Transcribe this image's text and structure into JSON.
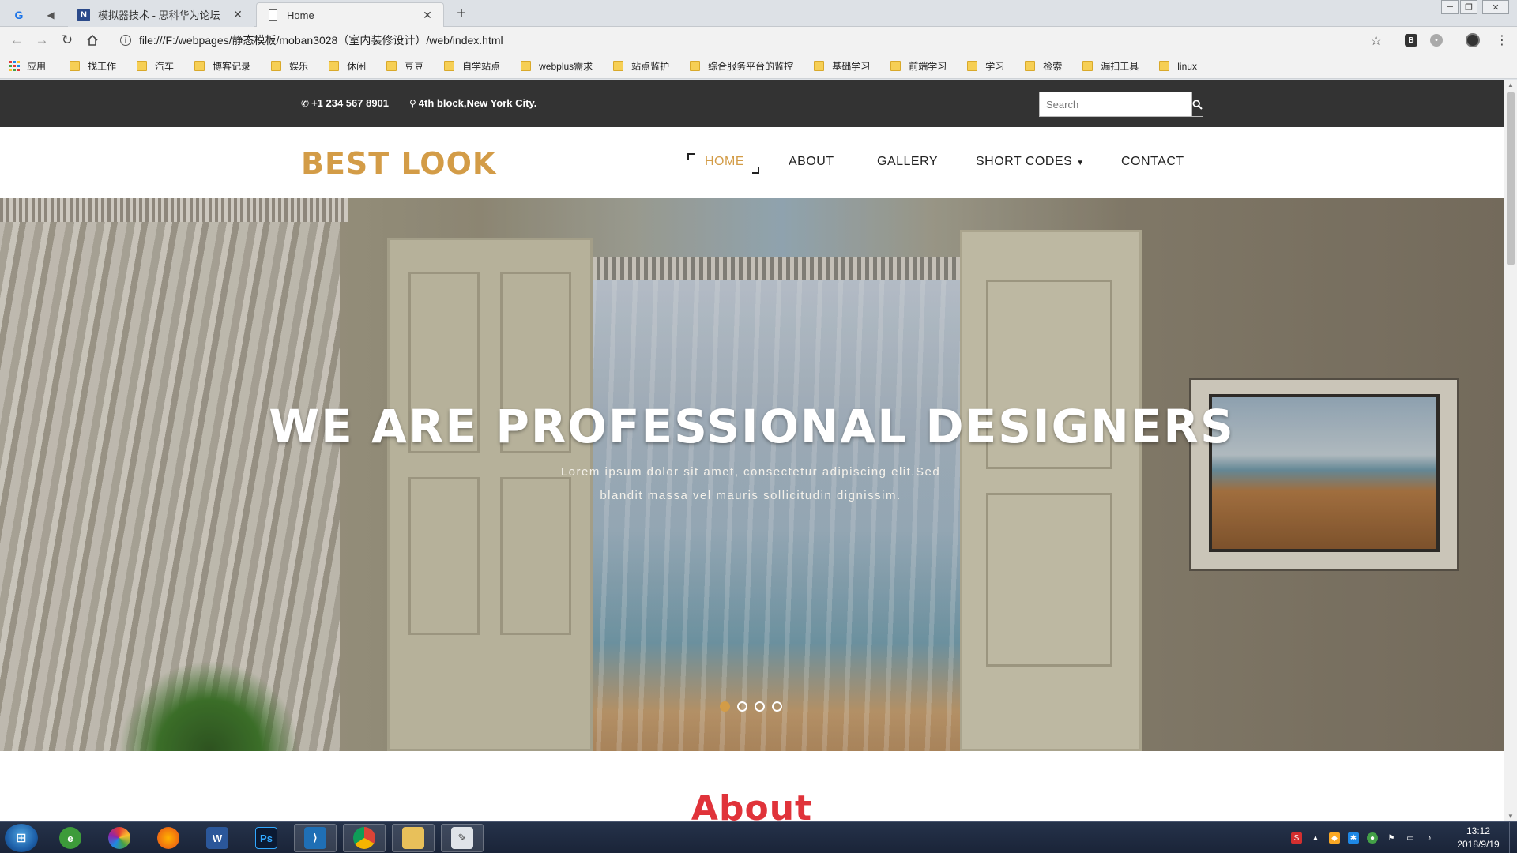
{
  "browser": {
    "pinned_tabs": [
      {
        "icon": "translate-icon"
      },
      {
        "icon": "audio-icon"
      }
    ],
    "tabs": [
      {
        "title": "模拟器技术 - 思科华为论坛",
        "active": false
      },
      {
        "title": "Home",
        "active": true
      }
    ],
    "url": "file:///F:/webpages/静态模板/moban3028（室内装修设计）/web/index.html",
    "bookmarks": [
      {
        "label": "应用",
        "icon": "apps-icon"
      },
      {
        "label": "找工作"
      },
      {
        "label": "汽车"
      },
      {
        "label": "博客记录"
      },
      {
        "label": "娱乐"
      },
      {
        "label": "休闲"
      },
      {
        "label": "豆豆"
      },
      {
        "label": "自学站点"
      },
      {
        "label": "webplus需求"
      },
      {
        "label": "站点监护"
      },
      {
        "label": "综合服务平台的监控"
      },
      {
        "label": "基础学习"
      },
      {
        "label": "前端学习"
      },
      {
        "label": "学习"
      },
      {
        "label": "检索"
      },
      {
        "label": "漏扫工具"
      },
      {
        "label": "linux"
      }
    ]
  },
  "site": {
    "phone": "+1 234 567 8901",
    "address": "4th block,New York City.",
    "search_placeholder": "Search",
    "logo": "BEST LOOK",
    "nav": {
      "home": "HOME",
      "about": "ABOUT",
      "gallery": "GALLERY",
      "short_codes": "SHORT CODES",
      "contact": "CONTACT"
    },
    "active_nav": "home",
    "hero": {
      "title": "WE ARE PROFESSIONAL DESIGNERS",
      "subtitle": "Lorem ipsum dolor sit amet, consectetur adipiscing elit.Sed blandit massa vel mauris sollicitudin dignissim.",
      "slide_count": 4,
      "active_slide": 1
    },
    "about_heading": "About"
  },
  "colors": {
    "accent": "#d39c47",
    "topbar": "#333333",
    "about_heading": "#e0333a"
  },
  "taskbar": {
    "apps": [
      {
        "name": "ie-icon"
      },
      {
        "name": "picasa-icon"
      },
      {
        "name": "firefox-icon"
      },
      {
        "name": "word-icon"
      },
      {
        "name": "photoshop-icon"
      },
      {
        "name": "vscode-icon"
      },
      {
        "name": "chrome-icon"
      },
      {
        "name": "explorer-icon"
      },
      {
        "name": "paint-icon"
      }
    ],
    "time": "13:12",
    "date": "2018/9/19"
  }
}
